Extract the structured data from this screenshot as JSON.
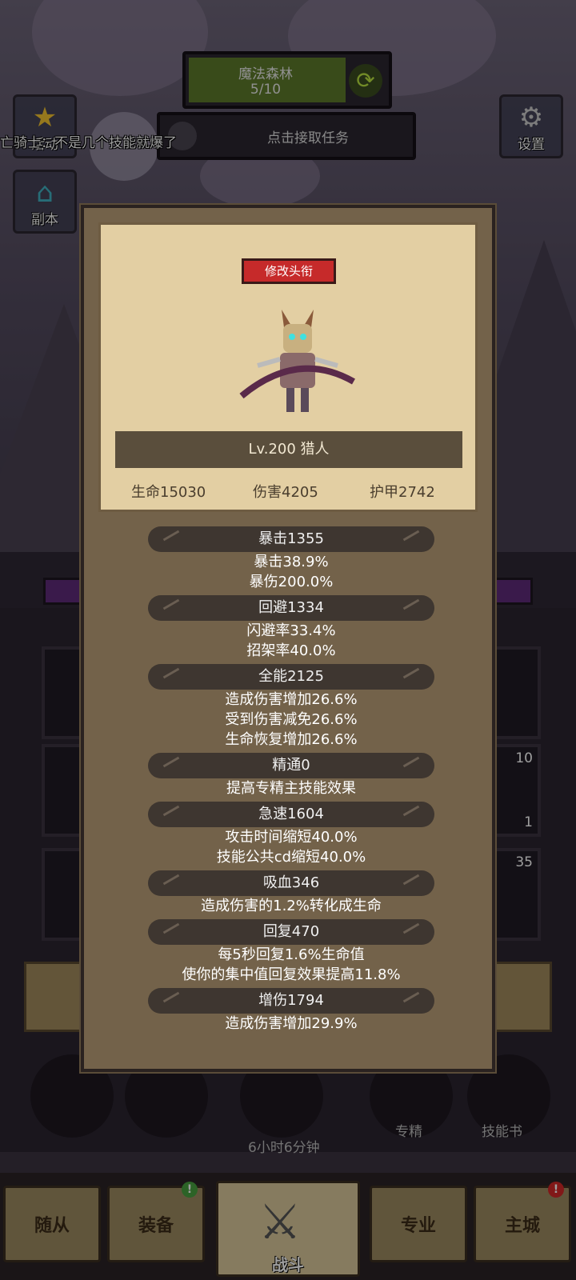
{
  "top": {
    "location_name": "魔法森林",
    "progress": "5/10",
    "quest_button": "点击接取任务",
    "settings_label": "设置",
    "events_label": "活动",
    "dungeon_label": "副本",
    "banner_text": "亡骑士：不是几个技能就爆了"
  },
  "hero": {
    "rename_button": "修改头衔",
    "level_label": "Lv.200 猎人",
    "hp_label": "生命15030",
    "damage_label": "伤害4205",
    "armor_label": "护甲2742"
  },
  "stats": [
    {
      "header": "暴击1355",
      "lines": [
        "暴击38.9%",
        "暴伤200.0%"
      ]
    },
    {
      "header": "回避1334",
      "lines": [
        "闪避率33.4%",
        "招架率40.0%"
      ]
    },
    {
      "header": "全能2125",
      "lines": [
        "造成伤害增加26.6%",
        "受到伤害减免26.6%",
        "生命恢复增加26.6%"
      ]
    },
    {
      "header": "精通0",
      "lines": [
        "提高专精主技能效果"
      ]
    },
    {
      "header": "急速1604",
      "lines": [
        "攻击时间缩短40.0%",
        "技能公共cd缩短40.0%"
      ]
    },
    {
      "header": "吸血346",
      "lines": [
        "造成伤害的1.2%转化成生命"
      ]
    },
    {
      "header": "回复470",
      "lines": [
        "每5秒回复1.6%生命值",
        "使你的集中值回复效果提高11.8%"
      ]
    },
    {
      "header": "增伤1794",
      "lines": [
        "造成伤害增加29.9%"
      ]
    }
  ],
  "lower": {
    "slot_counts": [
      "10",
      "1",
      "35"
    ],
    "timer_text": "6小时6分钟",
    "specialization_label": "专精",
    "skillbook_label": "技能书"
  },
  "nav": {
    "followers": "随从",
    "equipment": "装备",
    "battle": "战斗",
    "profession": "专业",
    "main_city": "主城",
    "equipment_badge": "!",
    "main_city_badge": "!"
  },
  "colors": {
    "accent_red": "#c62a2a",
    "modal_brown": "#73624a",
    "card_parchment": "#e3cfa3"
  }
}
